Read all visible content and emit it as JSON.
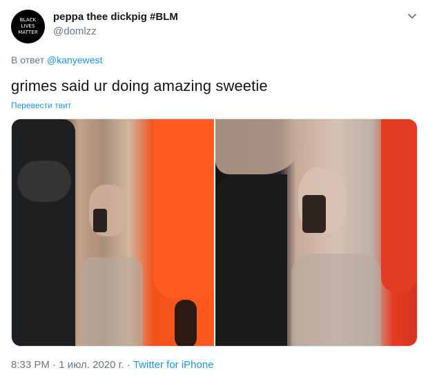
{
  "tweet": {
    "avatar_text": [
      "BLACK",
      "LIVES",
      "MATTER"
    ],
    "display_name": "peppa thee dickpig #BLM",
    "handle": "@domlzz",
    "reply_prefix": "В ответ",
    "reply_to": "@kanyewest",
    "text": "grimes said ur doing amazing sweetie",
    "translate_label": "Перевести твит",
    "time": "8:33 PM",
    "separator": "·",
    "date": "1 июл. 2020 г.",
    "source": "Twitter for iPhone"
  },
  "icons": {
    "more": "chevron-down-icon"
  },
  "colors": {
    "link": "#1b95e0",
    "secondary_text": "#657786",
    "primary_text": "#14171a"
  }
}
